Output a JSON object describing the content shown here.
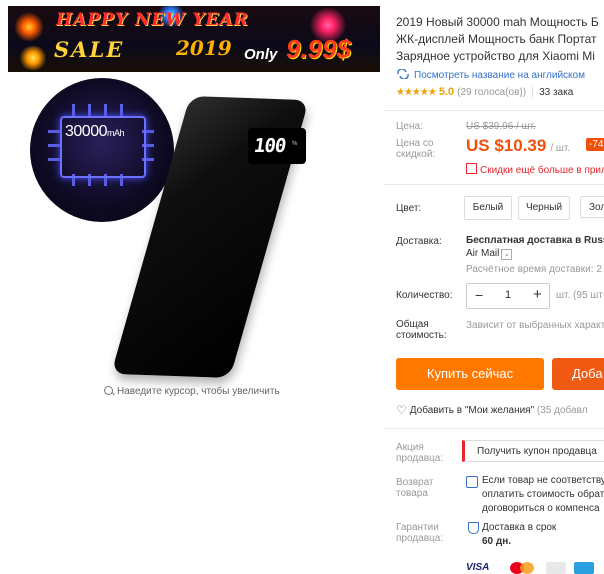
{
  "banner": {
    "headline": "HAPPY NEW YEAR",
    "sale": "SALE",
    "year": "2019",
    "only": "Only",
    "price": "9.99$"
  },
  "gallery": {
    "badge_capacity": "30000",
    "badge_unit": "mAh",
    "display_value": "100",
    "display_unit": "%",
    "zoom_hint": "Наведите курсор, чтобы увеличить"
  },
  "product": {
    "title_lines": [
      "2019 Новый 30000 mah Мощность Б",
      "ЖК-дисплей Мощность банк Портат",
      "Зарядное устройство для Xiaomi Mi"
    ],
    "translate_link": "Посмотреть название на английском",
    "stars": "★★★★★",
    "rating": "5.0",
    "votes": "(29 голоса(ов))",
    "orders": "33 зака"
  },
  "pricing": {
    "price_label": "Цена:",
    "old_price": "US $39.96 / шт.",
    "sale_label": "Цена со скидкой:",
    "sale_price": "US $10.39",
    "unit": "/ шт.",
    "discount": "-74",
    "coupon_text": "Скидки ещё больше в прил"
  },
  "options": {
    "color_label": "Цвет:",
    "colors": [
      "Белый",
      "Черный",
      "Золо"
    ]
  },
  "shipping": {
    "label": "Доставка:",
    "main": "Бесплатная доставка в Russ",
    "carrier": "Air Mail",
    "time": "Расчётное время доставки: 2"
  },
  "quantity": {
    "label": "Количество:",
    "minus": "−",
    "value": "1",
    "plus": "+",
    "unit": "шт. (95 шт"
  },
  "total": {
    "label_1": "Общая",
    "label_2": "стоимость:",
    "value": "Зависит от выбранных характ"
  },
  "actions": {
    "buy_now": "Купить сейчас",
    "add_to_cart": "Доба",
    "wishlist": "Добавить в \"Мои желания\"",
    "wishlist_count": "(35 добавл"
  },
  "seller": {
    "promo_label_1": "Акция",
    "promo_label_2": "продавца:",
    "promo_button": "Получить купон продавца",
    "return_label_1": "Возврат",
    "return_label_2": "товара",
    "return_lines": [
      "Если товар не соответству",
      "оплатить стоимость обрат",
      "договориться о компенса"
    ],
    "guarantee_label_1": "Гарантии",
    "guarantee_label_2": "продавца:",
    "guarantee_lines": [
      "Доставка в срок",
      "60 дн."
    ]
  },
  "payment": {
    "visa": "VISA"
  },
  "colors": {
    "accent_orange": "#ff7800",
    "price_red": "#f0500a",
    "link_blue": "#3670c9",
    "star_gold": "#f09e00"
  }
}
